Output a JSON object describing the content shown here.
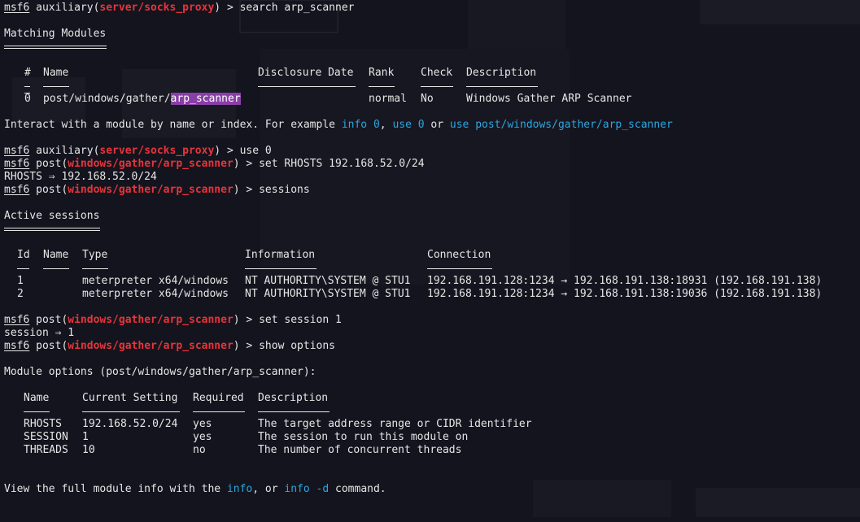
{
  "prompt": {
    "msf": "msf6",
    "aux_prefix": " auxiliary(",
    "aux_module": "server/socks_proxy",
    "post_prefix": " post(",
    "post_module": "windows/gather/arp_scanner",
    "suffix": ") > "
  },
  "commands": {
    "search": "search arp_scanner",
    "use": "use 0",
    "set_rhosts": "set RHOSTS 192.168.52.0/24",
    "sessions": "sessions",
    "set_session": "set session 1",
    "show_options": "show options"
  },
  "matching": {
    "heading": "Matching Modules",
    "headers": {
      "num": "#",
      "name": "Name",
      "date": "Disclosure Date",
      "rank": "Rank",
      "check": "Check",
      "desc": "Description"
    },
    "row": {
      "num": "0",
      "name_prefix": "post/windows/gather/",
      "name_match": "arp_scanner",
      "date": "",
      "rank": "normal",
      "check": "No",
      "desc": "Windows Gather ARP Scanner"
    }
  },
  "interact": {
    "text": "Interact with a module by name or index. For example ",
    "info": "info 0",
    "sep1": ", ",
    "use": "use 0",
    "or": " or ",
    "use_path": "use post/windows/gather/arp_scanner"
  },
  "outputs": {
    "rhosts": "RHOSTS ⇒ 192.168.52.0/24",
    "session": "session ⇒ 1"
  },
  "sessions": {
    "heading": "Active sessions",
    "headers": {
      "id": "Id",
      "name": "Name",
      "type": "Type",
      "info": "Information",
      "conn": "Connection"
    },
    "rows": [
      {
        "id": "1",
        "name": "",
        "type": "meterpreter x64/windows",
        "info": "NT AUTHORITY\\SYSTEM @ STU1",
        "conn": "192.168.191.128:1234 → 192.168.191.138:18931 (192.168.191.138)"
      },
      {
        "id": "2",
        "name": "",
        "type": "meterpreter x64/windows",
        "info": "NT AUTHORITY\\SYSTEM @ STU1",
        "conn": "192.168.191.128:1234 → 192.168.191.138:19036 (192.168.191.138)"
      }
    ]
  },
  "options": {
    "heading": "Module options (post/windows/gather/arp_scanner):",
    "headers": {
      "name": "Name",
      "setting": "Current Setting",
      "required": "Required",
      "desc": "Description"
    },
    "rows": [
      {
        "name": "RHOSTS",
        "setting": "192.168.52.0/24",
        "required": "yes",
        "desc": "The target address range or CIDR identifier"
      },
      {
        "name": "SESSION",
        "setting": "1",
        "required": "yes",
        "desc": "The session to run this module on"
      },
      {
        "name": "THREADS",
        "setting": "10",
        "required": "no",
        "desc": "The number of concurrent threads"
      }
    ]
  },
  "footer": {
    "pre": "View the full module info with the ",
    "info": "info",
    "mid": ", or ",
    "info_d": "info -d",
    "post": " command."
  }
}
